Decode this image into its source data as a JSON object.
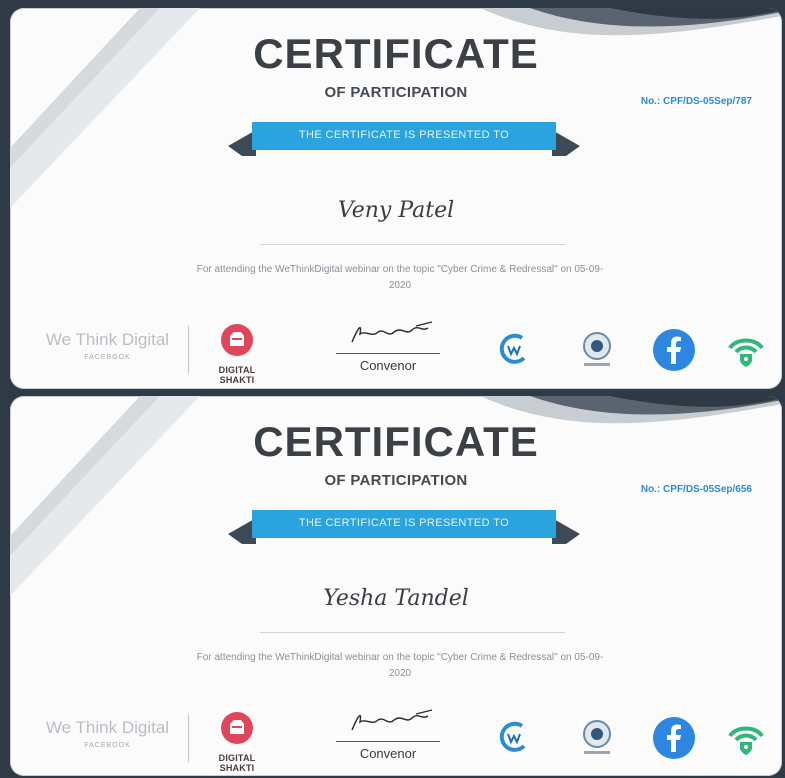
{
  "certificates": [
    {
      "title": "CERTIFICATE",
      "subtitle": "OF PARTICIPATION",
      "certificate_no": "No.: CPF/DS-05Sep/787",
      "ribbon_text": "THE CERTIFICATE IS PRESENTED TO",
      "recipient": "Veny Patel",
      "description": "For attending the WeThinkDigital webinar on the topic \"Cyber Crime & Redressal\" on 05-09-2020",
      "org_name": "We Think Digital",
      "org_sub": "FACEBOOK",
      "partner_label": "DIGITAL SHAKTI",
      "signatory_label": "Convenor"
    },
    {
      "title": "CERTIFICATE",
      "subtitle": "OF PARTICIPATION",
      "certificate_no": "No.: CPF/DS-05Sep/656",
      "ribbon_text": "THE CERTIFICATE IS PRESENTED TO",
      "recipient": "Yesha Tandel",
      "description": "For attending the WeThinkDigital webinar on the topic \"Cyber Crime & Redressal\" on 05-09-2020",
      "org_name": "We Think Digital",
      "org_sub": "FACEBOOK",
      "partner_label": "DIGITAL SHAKTI",
      "signatory_label": "Convenor"
    }
  ],
  "logos": [
    "wethinkdigital-logo",
    "digital-shakti-logo",
    "signature",
    "cyber-wellness-logo",
    "cyber-peace-logo",
    "facebook-icon",
    "shield-wifi-icon"
  ],
  "colors": {
    "ribbon": "#2aa3de",
    "ribbon_tail": "#3c4a58",
    "title": "#3b3f46",
    "certificate_no": "#2a8dd2",
    "facebook": "#2d87e0",
    "shield": "#2fb87a",
    "digital_shakti": "#e0455a"
  }
}
